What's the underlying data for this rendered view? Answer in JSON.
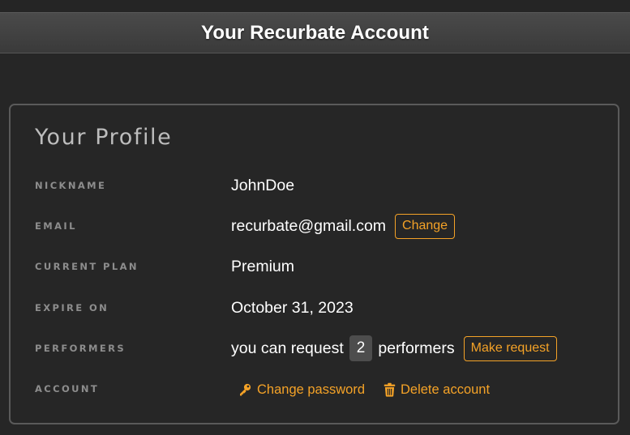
{
  "header": {
    "title": "Your Recurbate Account"
  },
  "profile": {
    "title": "Your Profile",
    "nickname": {
      "label": "NICKNAME",
      "value": "JohnDoe"
    },
    "email": {
      "label": "EMAIL",
      "value": "recurbate@gmail.com",
      "change_label": "Change"
    },
    "plan": {
      "label": "CURRENT PLAN",
      "value": "Premium"
    },
    "expire": {
      "label": "EXPIRE ON",
      "value": "October 31, 2023"
    },
    "performers": {
      "label": "PERFORMERS",
      "prefix": "you can request",
      "count": "2",
      "suffix": "performers",
      "request_label": "Make request"
    },
    "account": {
      "label": "ACCOUNT",
      "change_password_label": "Change password",
      "delete_account_label": "Delete account"
    }
  },
  "colors": {
    "accent": "#f4a227",
    "background": "#262626",
    "header_bg": "#414141",
    "panel_border": "#5a5a5a",
    "label_text": "#8d8d8d"
  },
  "icons": {
    "change_password": "key-icon",
    "delete_account": "trash-icon"
  }
}
